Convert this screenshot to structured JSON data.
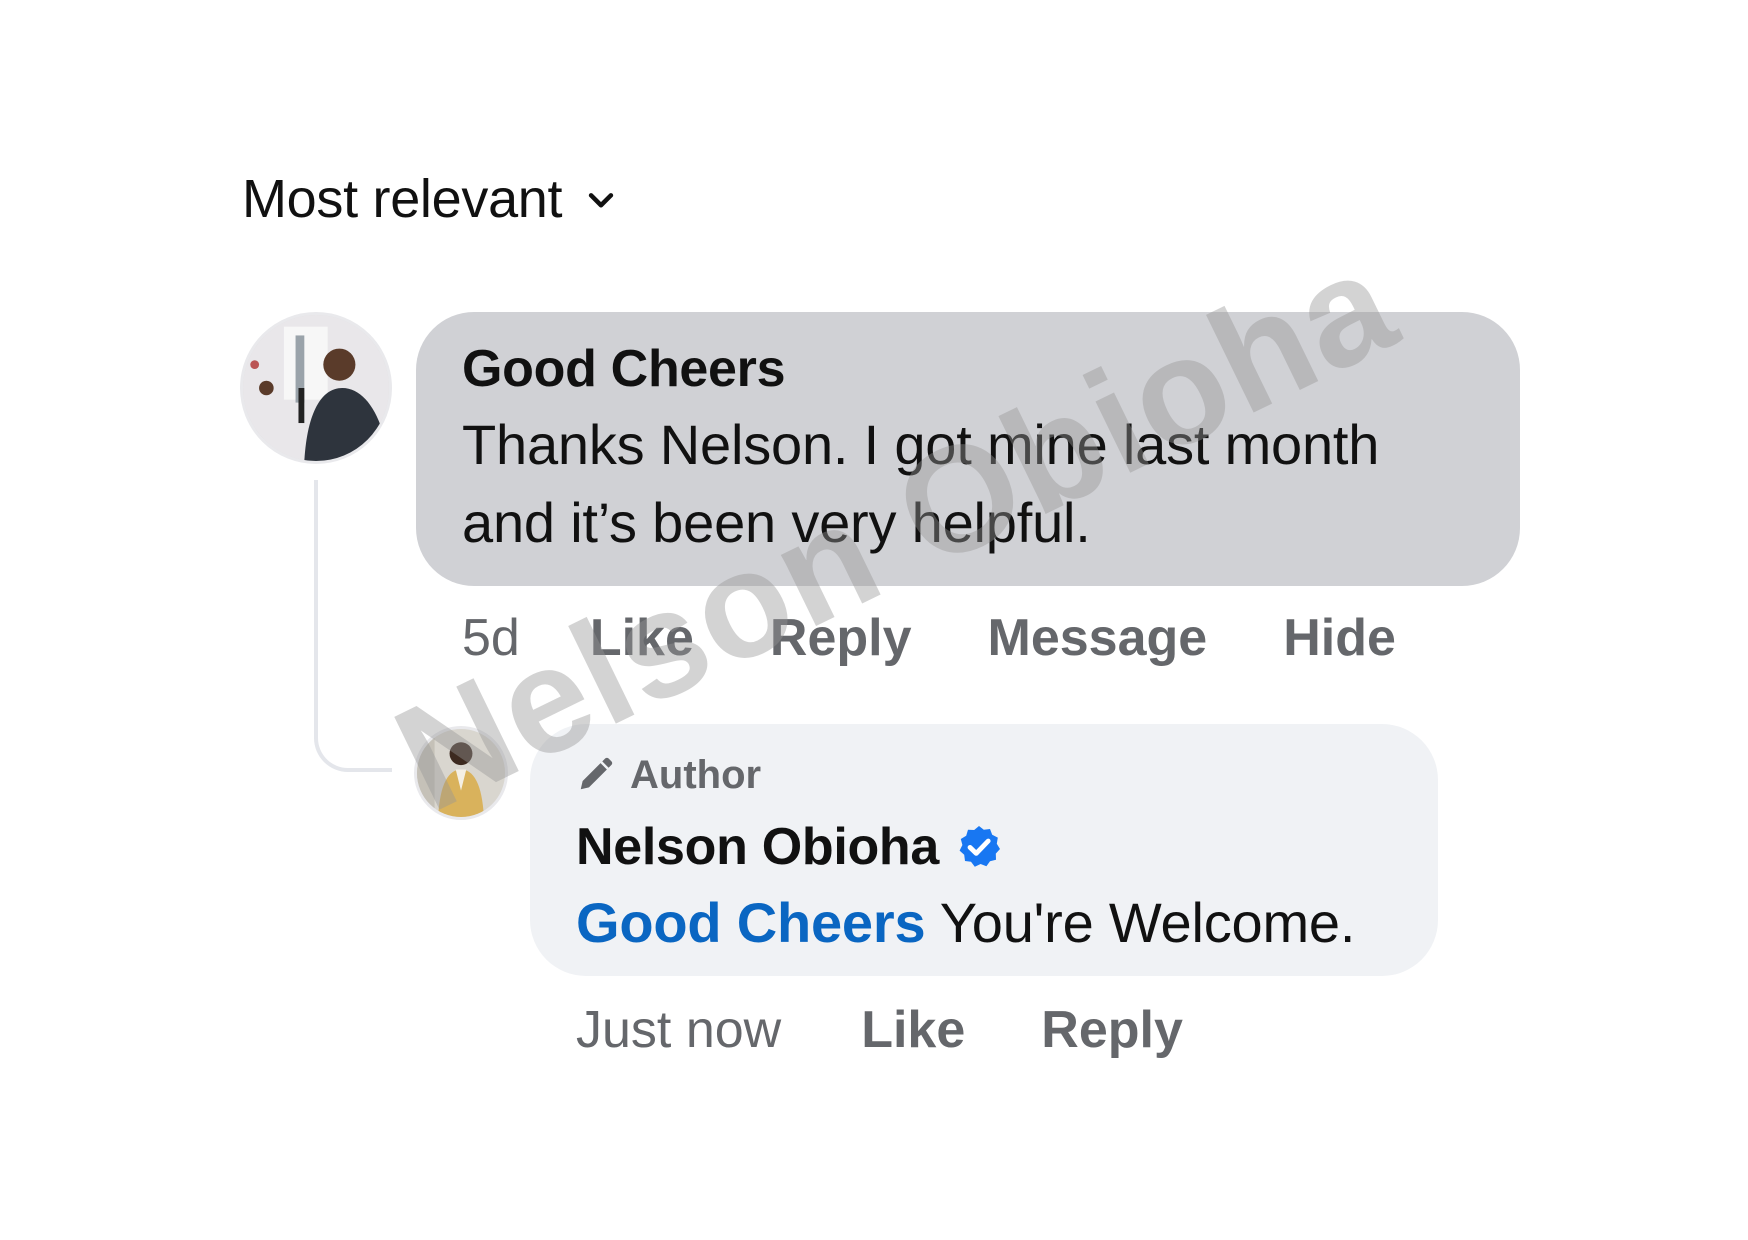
{
  "sort": {
    "label": "Most relevant",
    "icon": "chevron-down-icon"
  },
  "comment": {
    "author": "Good Cheers",
    "text": "Thanks Nelson. I got mine last month and it’s been very helpful.",
    "timestamp": "5d",
    "actions": [
      "Like",
      "Reply",
      "Message",
      "Hide"
    ]
  },
  "reply": {
    "badge": "Author",
    "author": "Nelson Obioha",
    "mention": "Good Cheers",
    "text": " You're Welcome.",
    "timestamp": "Just now",
    "actions": [
      "Like",
      "Reply"
    ]
  },
  "watermark": "Nelson Obioha",
  "colors": {
    "link": "#0a66c2",
    "verified": "#1877f2",
    "bubble_main": "#d0d1d5",
    "bubble_reply": "#f0f2f5",
    "meta": "#65676b"
  }
}
